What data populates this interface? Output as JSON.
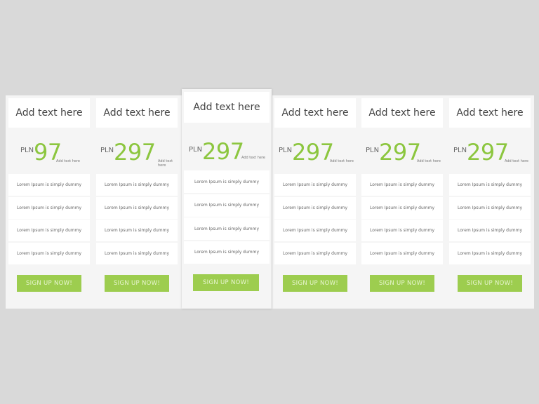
{
  "colors": {
    "background": "#d9d9d9",
    "card": "#f5f5f5",
    "accent": "#8cc63f",
    "button": "#9dcd4f"
  },
  "plans": [
    {
      "title": "Add text here",
      "currency": "PLN",
      "amount": "97",
      "amount_note": "Add text here",
      "features": [
        "Lorem Ipsum is simply dummy",
        "Lorem Ipsum is simply dummy",
        "Lorem Ipsum is simply dummy",
        "Lorem Ipsum is simply dummy"
      ],
      "button": "SIGN UP NOW!"
    },
    {
      "title": "Add text here",
      "currency": "PLN",
      "amount": "297",
      "amount_note": "Add text here",
      "features": [
        "Lorem Ipsum is simply dummy",
        "Lorem Ipsum is simply dummy",
        "Lorem Ipsum is simply dummy",
        "Lorem Ipsum is simply dummy"
      ],
      "button": "SIGN UP NOW!"
    },
    {
      "title": "Add text here",
      "currency": "PLN",
      "amount": "297",
      "amount_note": "Add text here",
      "featured": true,
      "features": [
        "Lorem Ipsum is simply dummy",
        "Lorem Ipsum is simply dummy",
        "Lorem Ipsum is simply dummy",
        "Lorem Ipsum is simply dummy"
      ],
      "button": "SIGN UP NOW!"
    },
    {
      "title": "Add text here",
      "currency": "PLN",
      "amount": "297",
      "amount_note": "Add text here",
      "features": [
        "Lorem Ipsum is simply dummy",
        "Lorem Ipsum is simply dummy",
        "Lorem Ipsum is simply dummy",
        "Lorem Ipsum is simply dummy"
      ],
      "button": "SIGN UP NOW!"
    },
    {
      "title": "Add text here",
      "currency": "PLN",
      "amount": "297",
      "amount_note": "Add text here",
      "features": [
        "Lorem Ipsum is simply dummy",
        "Lorem Ipsum is simply dummy",
        "Lorem Ipsum is simply dummy",
        "Lorem Ipsum is simply dummy"
      ],
      "button": "SIGN UP NOW!"
    },
    {
      "title": "Add text here",
      "currency": "PLN",
      "amount": "297",
      "amount_note": "Add text here",
      "features": [
        "Lorem Ipsum is simply dummy",
        "Lorem Ipsum is simply dummy",
        "Lorem Ipsum is simply dummy",
        "Lorem Ipsum is simply dummy"
      ],
      "button": "SIGN UP NOW!"
    }
  ]
}
